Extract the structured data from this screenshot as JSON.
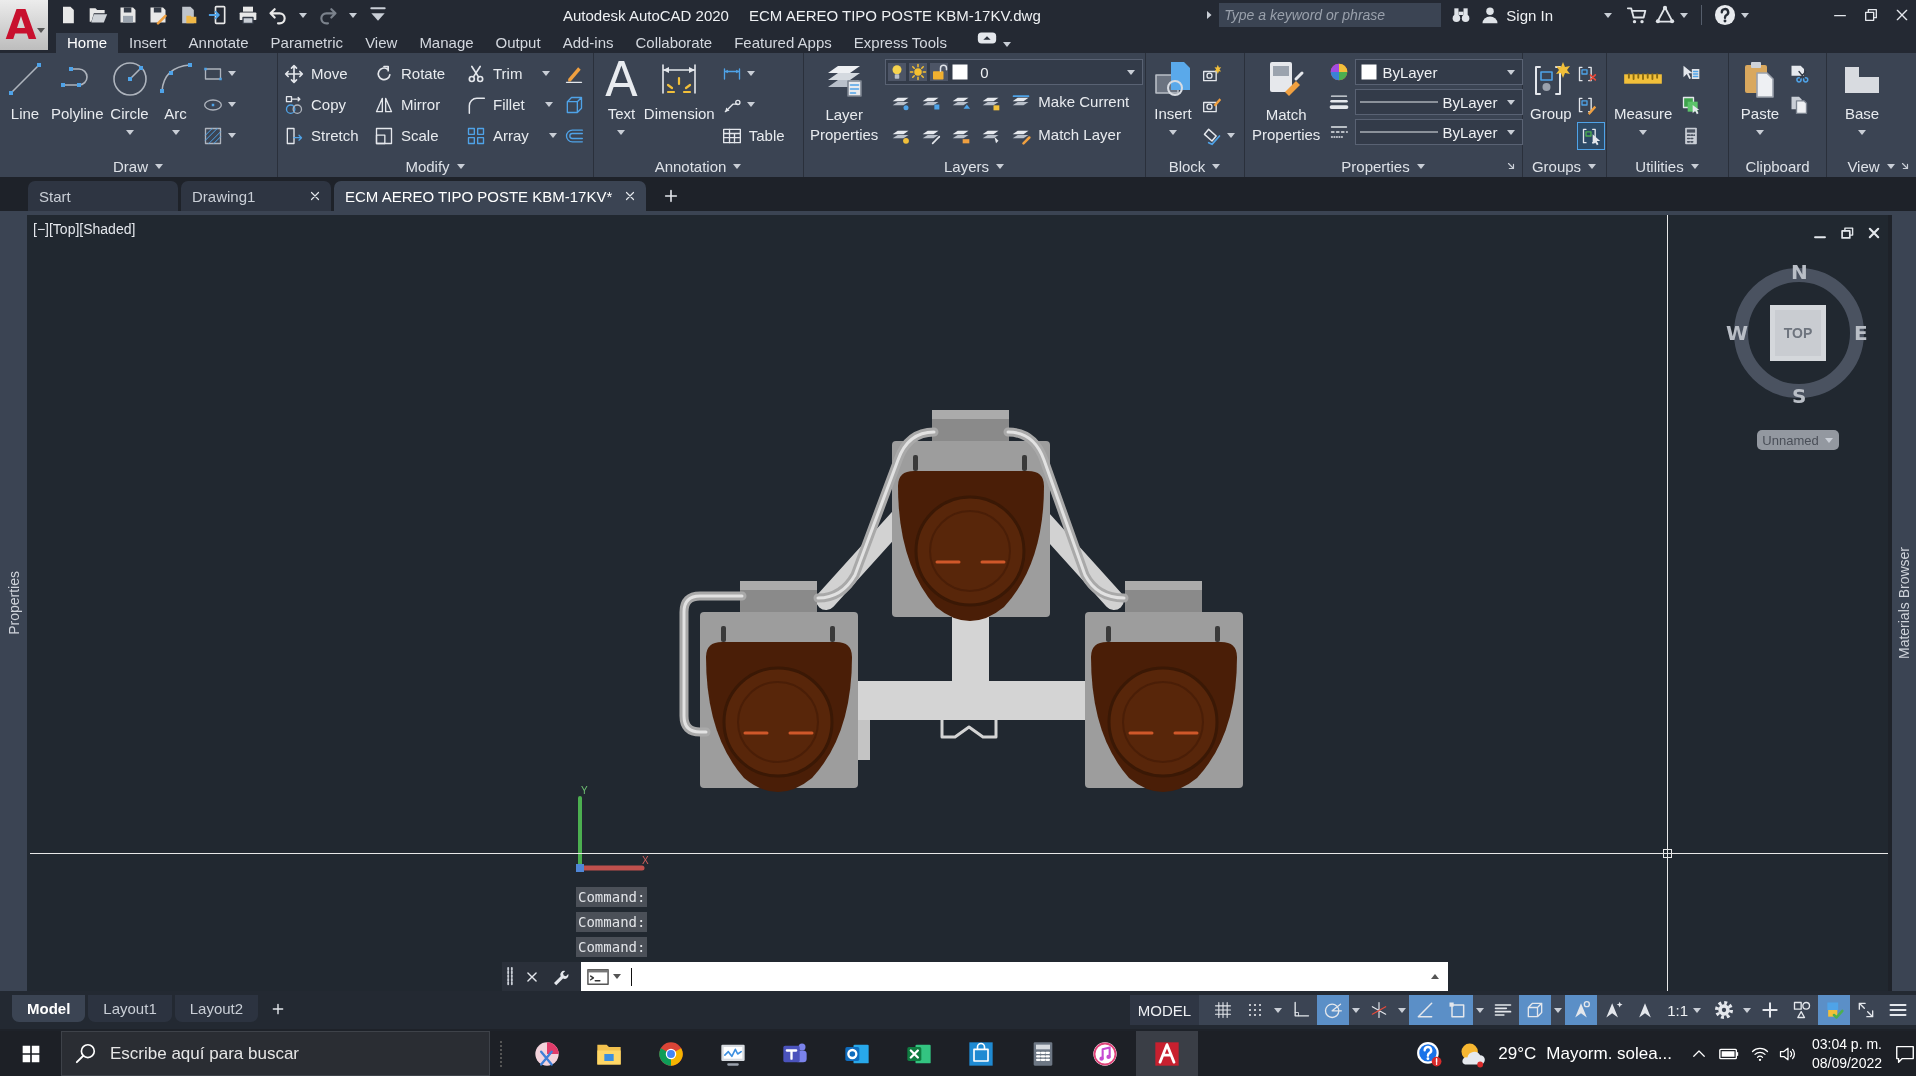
{
  "title_bar": {
    "logo": "A",
    "app_name": "Autodesk AutoCAD 2020",
    "file_name": "ECM AEREO TIPO POSTE KBM-17KV.dwg",
    "search": {
      "placeholder": "Type a keyword or phrase"
    },
    "sign_in": "Sign In"
  },
  "ribbon_tabs": [
    {
      "label": "Home",
      "selected": true
    },
    {
      "label": "Insert",
      "selected": false
    },
    {
      "label": "Annotate",
      "selected": false
    },
    {
      "label": "Parametric",
      "selected": false
    },
    {
      "label": "View",
      "selected": false
    },
    {
      "label": "Manage",
      "selected": false
    },
    {
      "label": "Output",
      "selected": false
    },
    {
      "label": "Add-ins",
      "selected": false
    },
    {
      "label": "Collaborate",
      "selected": false
    },
    {
      "label": "Featured Apps",
      "selected": false
    },
    {
      "label": "Express Tools",
      "selected": false
    }
  ],
  "ribbon_panels": [
    {
      "title": "Draw",
      "tools": [
        "Line",
        "Polyline",
        "Circle",
        "Arc"
      ]
    },
    {
      "title": "Modify",
      "tools": [
        "Move",
        "Copy",
        "Stretch",
        "Rotate",
        "Mirror",
        "Scale",
        "Trim",
        "Fillet",
        "Array"
      ]
    },
    {
      "title": "Annotation",
      "glyph": "A",
      "tools": [
        "Text",
        "Dimension",
        "Table"
      ]
    },
    {
      "title": "Layers",
      "tools": [
        "Layer Properties",
        "Make Current",
        "Match Layer"
      ],
      "current_layer": "0"
    },
    {
      "title": "Block",
      "tools": [
        "Insert"
      ]
    },
    {
      "title": "Properties",
      "tools": [
        "Match Properties"
      ],
      "dropdowns": [
        "ByLayer",
        "ByLayer",
        "ByLayer"
      ]
    },
    {
      "title": "Groups",
      "tools": [
        "Group"
      ],
      "toggle": {
        "on": true
      }
    },
    {
      "title": "Utilities",
      "tools": [
        "Measure"
      ]
    },
    {
      "title": "Clipboard",
      "tools": [
        "Paste"
      ]
    },
    {
      "title": "View",
      "tools": [
        "Base"
      ]
    }
  ],
  "file_tabs": [
    {
      "label": "Start",
      "selected": false,
      "closable": false
    },
    {
      "label": "Drawing1",
      "selected": false,
      "closable": true
    },
    {
      "label": "ECM AEREO TIPO POSTE KBM-17KV*",
      "selected": true,
      "closable": true
    }
  ],
  "side_palettes": {
    "left": "Properties",
    "right": "Materials Browser"
  },
  "viewport": {
    "label": "[−][Top][Shaded]",
    "ucs": {
      "y_axis": "Y",
      "x_axis": "X"
    },
    "viewcube": {
      "north": "N",
      "west": "W",
      "east": "E",
      "south": "S",
      "face": "TOP",
      "ucs_menu": "Unnamed"
    }
  },
  "command_line": {
    "history": [
      "Command:",
      "Command:",
      "Command:"
    ]
  },
  "layout_tabs": [
    {
      "label": "Model",
      "selected": true
    },
    {
      "label": "Layout1",
      "selected": false
    },
    {
      "label": "Layout2",
      "selected": false
    }
  ],
  "status_bar": {
    "space": "MODEL",
    "toggles": [
      {
        "on": false
      },
      {
        "on": false
      },
      {
        "on": false
      },
      {
        "on": true
      },
      {
        "on": false
      },
      {
        "on": true
      },
      {
        "on": true
      },
      {
        "on": false
      },
      {
        "on": true
      },
      {
        "on": true
      },
      {
        "on": false
      },
      {
        "on": true
      }
    ],
    "annotation_scale": "1:1"
  },
  "taskbar": {
    "search": {
      "placeholder": "Escribe aquí para buscar"
    },
    "apps": [
      {
        "active": false
      },
      {
        "active": false
      },
      {
        "active": false
      },
      {
        "active": false
      },
      {
        "active": false
      },
      {
        "active": false
      },
      {
        "active": false
      },
      {
        "active": false
      },
      {
        "active": false
      },
      {
        "active": false
      },
      {
        "active": true
      }
    ],
    "weather": {
      "temperature": "29°C",
      "condition": "Mayorm. solea..."
    },
    "time": "03:04 p. m.",
    "date": "08/09/2022"
  }
}
